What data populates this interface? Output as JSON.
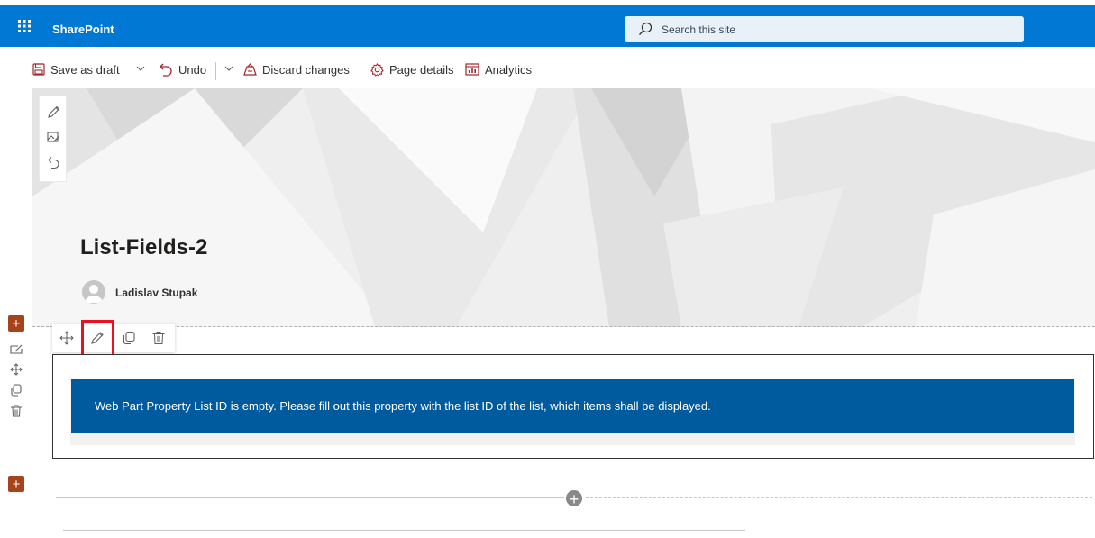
{
  "suite": {
    "app_name": "SharePoint",
    "search_placeholder": "Search this site",
    "brand_color": "#0078d4"
  },
  "command_bar": {
    "save_as_draft": "Save as draft",
    "undo": "Undo",
    "discard_changes": "Discard changes",
    "page_details": "Page details",
    "analytics": "Analytics"
  },
  "hero": {
    "title": "List-Fields-2",
    "author": "Ladislav Stupak"
  },
  "webpart": {
    "message": "Web Part Property List ID is empty. Please fill out this property with the list ID of the list, which items shall be displayed.",
    "message_bg": "#005a9e"
  },
  "icons": {
    "waffle": "waffle-icon",
    "search": "search-icon",
    "save": "save-icon",
    "undo": "undo-icon",
    "discard": "discard-icon",
    "page_details": "gear-icon",
    "analytics": "analytics-icon",
    "edit": "pencil-icon",
    "move": "move-icon",
    "duplicate": "duplicate-icon",
    "delete": "trash-icon",
    "add": "plus-icon"
  }
}
